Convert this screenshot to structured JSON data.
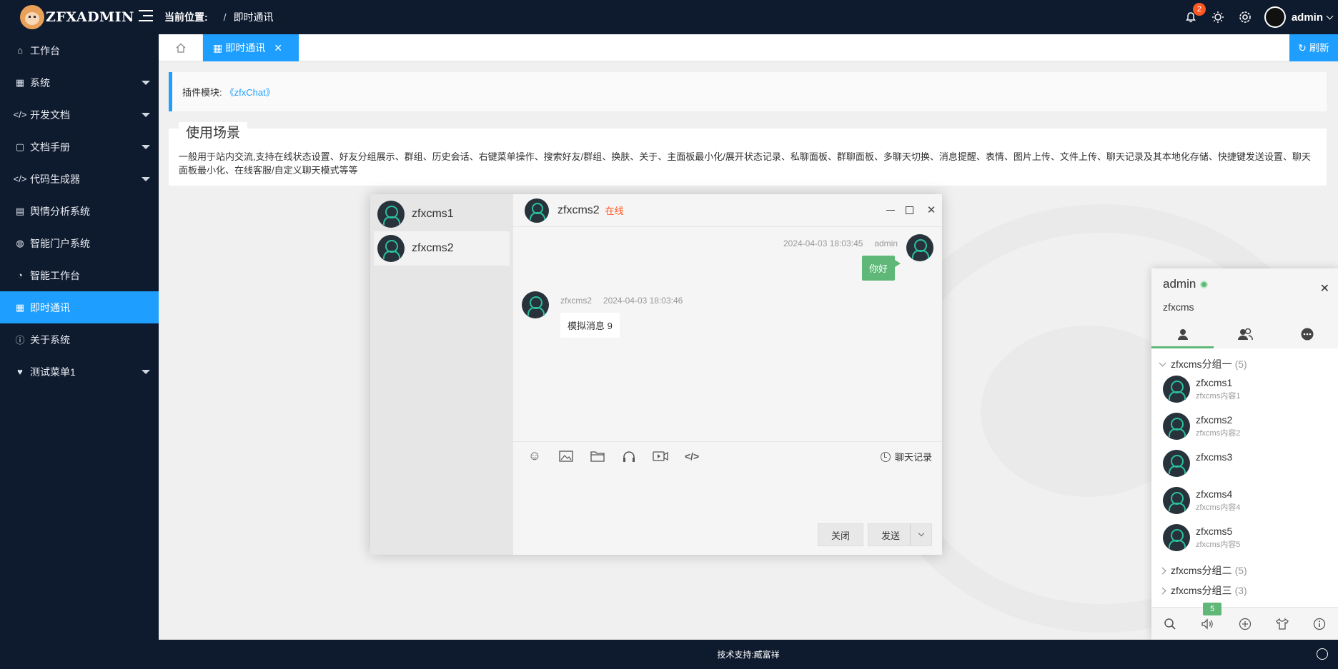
{
  "brand": {
    "logo_text": "ZFXADMIN"
  },
  "sidebar": {
    "items": [
      {
        "label": "工作台",
        "icon": "home-icon"
      },
      {
        "label": "系统",
        "icon": "grid-icon"
      },
      {
        "label": "开发文档",
        "icon": "code-icon"
      },
      {
        "label": "文档手册",
        "icon": "note-icon"
      },
      {
        "label": "代码生成器",
        "icon": "code-icon"
      },
      {
        "label": "舆情分析系统",
        "icon": "chart-icon"
      },
      {
        "label": "智能门户系统",
        "icon": "globe-icon"
      },
      {
        "label": "智能工作台",
        "icon": "gauge-icon"
      },
      {
        "label": "即时通讯",
        "icon": "grid-icon"
      },
      {
        "label": "关于系统",
        "icon": "info-icon"
      },
      {
        "label": "测试菜单1",
        "icon": "heart-icon"
      }
    ]
  },
  "header": {
    "crumb_label": "当前位置:",
    "crumb_sep": "/",
    "crumb_current": "即时通讯",
    "notification_count": "2",
    "username": "admin"
  },
  "tabs": {
    "active_label": "即时通讯",
    "refresh_label": "刷新"
  },
  "notice": {
    "label": "插件模块:",
    "link": "《zfxChat》"
  },
  "usage": {
    "legend": "使用场景",
    "text": "一般用于站内交流,支持在线状态设置、好友分组展示、群组、历史会话、右键菜单操作、搜索好友/群组、换肤、关于、主面板最小化/展开状态记录、私聊面板、群聊面板、多聊天切换、消息提醒、表情、图片上传、文件上传、聊天记录及其本地化存储、快捷键发送设置、聊天面板最小化、在线客服/自定义聊天模式等等"
  },
  "chat": {
    "list": [
      "zfxcms1",
      "zfxcms2"
    ],
    "title": "zfxcms2",
    "status": "在线",
    "messages": {
      "mine": {
        "time": "2024-04-03 18:03:45",
        "user": "admin",
        "text": "你好"
      },
      "theirs": {
        "user": "zfxcms2",
        "time": "2024-04-03 18:03:46",
        "text": "模拟消息 9"
      }
    },
    "history_label": "聊天记录",
    "close_label": "关闭",
    "send_label": "发送"
  },
  "panel": {
    "user": "admin",
    "sign": "zfxcms",
    "groups": [
      {
        "name": "zfxcms分组一",
        "count": "(5)"
      },
      {
        "name": "zfxcms分组二",
        "count": "(5)"
      },
      {
        "name": "zfxcms分组三",
        "count": "(3)"
      }
    ],
    "friends": [
      {
        "name": "zfxcms1",
        "sign": "zfxcms内容1"
      },
      {
        "name": "zfxcms2",
        "sign": "zfxcms内容2"
      },
      {
        "name": "zfxcms3",
        "sign": ""
      },
      {
        "name": "zfxcms4",
        "sign": "zfxcms内容4"
      },
      {
        "name": "zfxcms5",
        "sign": "zfxcms内容5"
      }
    ],
    "msgbox_count": "5"
  },
  "footer": {
    "text": "技术支持:臧富祥"
  },
  "colors": {
    "accent": "#1e9fff",
    "sidebar_bg": "#0e1a2e",
    "green": "#5fb878",
    "badge": "#ff5722"
  }
}
